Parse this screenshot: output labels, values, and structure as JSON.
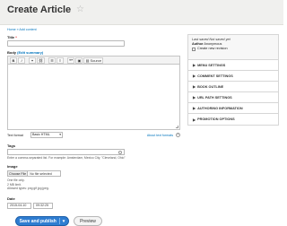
{
  "header": {
    "title": "Create Article",
    "star_icon": "star-icon"
  },
  "breadcrumb": {
    "home": "Home",
    "sep": "»",
    "add": "Add content"
  },
  "title_field": {
    "label": "Title",
    "required": "*",
    "value": ""
  },
  "body_field": {
    "label": "Body",
    "summary_link": "(Edit summary)",
    "toolbar": {
      "bold": "B",
      "italic": "I",
      "link": "⚭",
      "unlink": "⛓",
      "bullets": "☰",
      "numbers": "≡",
      "quote": "❝❞",
      "image": "▣",
      "source": "Source"
    }
  },
  "text_format": {
    "label": "Text format",
    "value": "Basic HTML",
    "about": "About text formats"
  },
  "tags": {
    "label": "Tags",
    "value": "",
    "help": "Enter a comma-separated list. For example: Amsterdam, Mexico City, \"Cleveland, Ohio\""
  },
  "image": {
    "label": "Image",
    "button": "Choose File",
    "status": "No file selected",
    "help1": "One file only.",
    "help2": "2 MB limit.",
    "help3": "Allowed types: png gif jpg jpeg."
  },
  "date": {
    "label": "Date",
    "date_value": "2015-04-10",
    "time_value": "09:32:25"
  },
  "actions": {
    "save": "Save and publish",
    "save_arrow": "▾",
    "preview": "Preview"
  },
  "sidebar": {
    "saved_line": "Last saved Not saved yet",
    "author_label": "Author",
    "author_value": "Anonymous",
    "revision_label": "Create new revision",
    "items": [
      {
        "label": "Menu settings"
      },
      {
        "label": "Comment settings"
      },
      {
        "label": "Book outline"
      },
      {
        "label": "URL path settings"
      },
      {
        "label": "Authoring information"
      },
      {
        "label": "Promotion options"
      }
    ],
    "arrow": "▶"
  }
}
